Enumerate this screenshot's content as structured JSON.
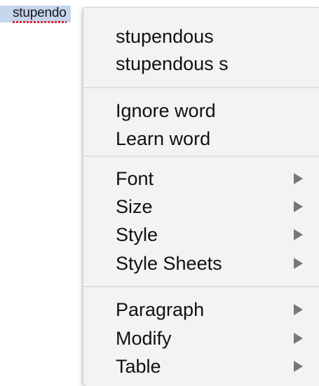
{
  "document": {
    "misspelled_word": "stupendo"
  },
  "context_menu": {
    "suggestions": [
      "stupendous",
      "stupendous s"
    ],
    "spell_actions": {
      "ignore_label": "Ignore word",
      "learn_label": "Learn word"
    },
    "format_items": [
      {
        "label": "Font",
        "has_submenu": true
      },
      {
        "label": "Size",
        "has_submenu": true
      },
      {
        "label": "Style",
        "has_submenu": true
      },
      {
        "label": "Style Sheets",
        "has_submenu": true
      }
    ],
    "edit_items": [
      {
        "label": "Paragraph",
        "has_submenu": true
      },
      {
        "label": "Modify",
        "has_submenu": true
      },
      {
        "label": "Table",
        "has_submenu": true
      }
    ],
    "icons": {
      "submenu_arrow": "triangle-right-icon"
    },
    "colors": {
      "menu_background": "#f3f3f3",
      "selection_highlight": "#c5d5eb",
      "spelling_underline": "#e0242d",
      "arrow": "#777777"
    }
  }
}
